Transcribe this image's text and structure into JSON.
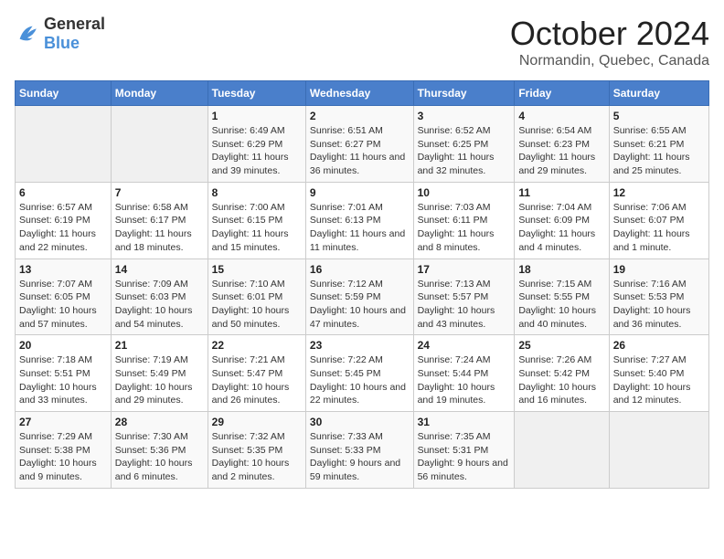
{
  "header": {
    "logo_general": "General",
    "logo_blue": "Blue",
    "month": "October 2024",
    "location": "Normandin, Quebec, Canada"
  },
  "weekdays": [
    "Sunday",
    "Monday",
    "Tuesday",
    "Wednesday",
    "Thursday",
    "Friday",
    "Saturday"
  ],
  "weeks": [
    [
      {
        "day": "",
        "empty": true
      },
      {
        "day": "",
        "empty": true
      },
      {
        "day": "1",
        "sunrise": "Sunrise: 6:49 AM",
        "sunset": "Sunset: 6:29 PM",
        "daylight": "Daylight: 11 hours and 39 minutes."
      },
      {
        "day": "2",
        "sunrise": "Sunrise: 6:51 AM",
        "sunset": "Sunset: 6:27 PM",
        "daylight": "Daylight: 11 hours and 36 minutes."
      },
      {
        "day": "3",
        "sunrise": "Sunrise: 6:52 AM",
        "sunset": "Sunset: 6:25 PM",
        "daylight": "Daylight: 11 hours and 32 minutes."
      },
      {
        "day": "4",
        "sunrise": "Sunrise: 6:54 AM",
        "sunset": "Sunset: 6:23 PM",
        "daylight": "Daylight: 11 hours and 29 minutes."
      },
      {
        "day": "5",
        "sunrise": "Sunrise: 6:55 AM",
        "sunset": "Sunset: 6:21 PM",
        "daylight": "Daylight: 11 hours and 25 minutes."
      }
    ],
    [
      {
        "day": "6",
        "sunrise": "Sunrise: 6:57 AM",
        "sunset": "Sunset: 6:19 PM",
        "daylight": "Daylight: 11 hours and 22 minutes."
      },
      {
        "day": "7",
        "sunrise": "Sunrise: 6:58 AM",
        "sunset": "Sunset: 6:17 PM",
        "daylight": "Daylight: 11 hours and 18 minutes."
      },
      {
        "day": "8",
        "sunrise": "Sunrise: 7:00 AM",
        "sunset": "Sunset: 6:15 PM",
        "daylight": "Daylight: 11 hours and 15 minutes."
      },
      {
        "day": "9",
        "sunrise": "Sunrise: 7:01 AM",
        "sunset": "Sunset: 6:13 PM",
        "daylight": "Daylight: 11 hours and 11 minutes."
      },
      {
        "day": "10",
        "sunrise": "Sunrise: 7:03 AM",
        "sunset": "Sunset: 6:11 PM",
        "daylight": "Daylight: 11 hours and 8 minutes."
      },
      {
        "day": "11",
        "sunrise": "Sunrise: 7:04 AM",
        "sunset": "Sunset: 6:09 PM",
        "daylight": "Daylight: 11 hours and 4 minutes."
      },
      {
        "day": "12",
        "sunrise": "Sunrise: 7:06 AM",
        "sunset": "Sunset: 6:07 PM",
        "daylight": "Daylight: 11 hours and 1 minute."
      }
    ],
    [
      {
        "day": "13",
        "sunrise": "Sunrise: 7:07 AM",
        "sunset": "Sunset: 6:05 PM",
        "daylight": "Daylight: 10 hours and 57 minutes."
      },
      {
        "day": "14",
        "sunrise": "Sunrise: 7:09 AM",
        "sunset": "Sunset: 6:03 PM",
        "daylight": "Daylight: 10 hours and 54 minutes."
      },
      {
        "day": "15",
        "sunrise": "Sunrise: 7:10 AM",
        "sunset": "Sunset: 6:01 PM",
        "daylight": "Daylight: 10 hours and 50 minutes."
      },
      {
        "day": "16",
        "sunrise": "Sunrise: 7:12 AM",
        "sunset": "Sunset: 5:59 PM",
        "daylight": "Daylight: 10 hours and 47 minutes."
      },
      {
        "day": "17",
        "sunrise": "Sunrise: 7:13 AM",
        "sunset": "Sunset: 5:57 PM",
        "daylight": "Daylight: 10 hours and 43 minutes."
      },
      {
        "day": "18",
        "sunrise": "Sunrise: 7:15 AM",
        "sunset": "Sunset: 5:55 PM",
        "daylight": "Daylight: 10 hours and 40 minutes."
      },
      {
        "day": "19",
        "sunrise": "Sunrise: 7:16 AM",
        "sunset": "Sunset: 5:53 PM",
        "daylight": "Daylight: 10 hours and 36 minutes."
      }
    ],
    [
      {
        "day": "20",
        "sunrise": "Sunrise: 7:18 AM",
        "sunset": "Sunset: 5:51 PM",
        "daylight": "Daylight: 10 hours and 33 minutes."
      },
      {
        "day": "21",
        "sunrise": "Sunrise: 7:19 AM",
        "sunset": "Sunset: 5:49 PM",
        "daylight": "Daylight: 10 hours and 29 minutes."
      },
      {
        "day": "22",
        "sunrise": "Sunrise: 7:21 AM",
        "sunset": "Sunset: 5:47 PM",
        "daylight": "Daylight: 10 hours and 26 minutes."
      },
      {
        "day": "23",
        "sunrise": "Sunrise: 7:22 AM",
        "sunset": "Sunset: 5:45 PM",
        "daylight": "Daylight: 10 hours and 22 minutes."
      },
      {
        "day": "24",
        "sunrise": "Sunrise: 7:24 AM",
        "sunset": "Sunset: 5:44 PM",
        "daylight": "Daylight: 10 hours and 19 minutes."
      },
      {
        "day": "25",
        "sunrise": "Sunrise: 7:26 AM",
        "sunset": "Sunset: 5:42 PM",
        "daylight": "Daylight: 10 hours and 16 minutes."
      },
      {
        "day": "26",
        "sunrise": "Sunrise: 7:27 AM",
        "sunset": "Sunset: 5:40 PM",
        "daylight": "Daylight: 10 hours and 12 minutes."
      }
    ],
    [
      {
        "day": "27",
        "sunrise": "Sunrise: 7:29 AM",
        "sunset": "Sunset: 5:38 PM",
        "daylight": "Daylight: 10 hours and 9 minutes."
      },
      {
        "day": "28",
        "sunrise": "Sunrise: 7:30 AM",
        "sunset": "Sunset: 5:36 PM",
        "daylight": "Daylight: 10 hours and 6 minutes."
      },
      {
        "day": "29",
        "sunrise": "Sunrise: 7:32 AM",
        "sunset": "Sunset: 5:35 PM",
        "daylight": "Daylight: 10 hours and 2 minutes."
      },
      {
        "day": "30",
        "sunrise": "Sunrise: 7:33 AM",
        "sunset": "Sunset: 5:33 PM",
        "daylight": "Daylight: 9 hours and 59 minutes."
      },
      {
        "day": "31",
        "sunrise": "Sunrise: 7:35 AM",
        "sunset": "Sunset: 5:31 PM",
        "daylight": "Daylight: 9 hours and 56 minutes."
      },
      {
        "day": "",
        "empty": true
      },
      {
        "day": "",
        "empty": true
      }
    ]
  ]
}
